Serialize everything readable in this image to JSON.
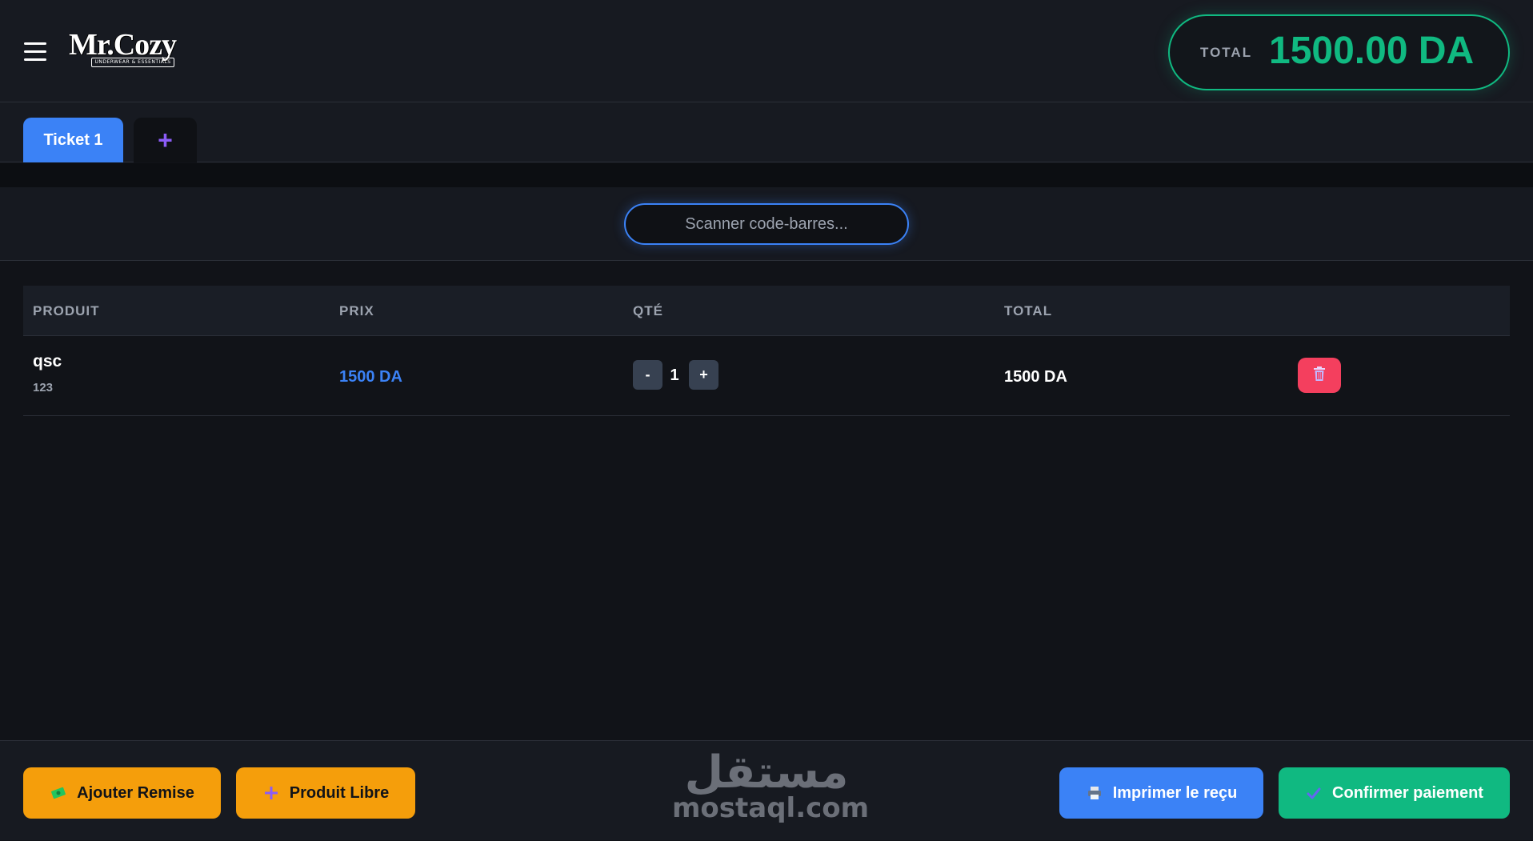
{
  "header": {
    "logo_text": "Mr.Cozy",
    "logo_tagline": "UNDERWEAR & ESSENTIALS",
    "total_label": "TOTAL",
    "total_value": "1500.00 DA"
  },
  "tabs": {
    "items": [
      {
        "label": "Ticket 1",
        "active": true
      }
    ],
    "add_label": "+"
  },
  "scanner": {
    "placeholder": "Scanner code-barres..."
  },
  "table": {
    "columns": [
      "PRODUIT",
      "PRIX",
      "QTÉ",
      "TOTAL"
    ],
    "rows": [
      {
        "name": "qsc",
        "code": "123",
        "price": "1500 DA",
        "qty": "1",
        "total": "1500 DA",
        "minus_label": "-",
        "plus_label": "+"
      }
    ]
  },
  "footer": {
    "buttons": {
      "remise": "Ajouter Remise",
      "libre": "Produit Libre",
      "print": "Imprimer le reçu",
      "confirm": "Confirmer paiement"
    },
    "watermark_ar": "مستقل",
    "watermark_en": "mostaql.com"
  },
  "colors": {
    "accent_blue": "#3b82f6",
    "accent_green": "#10b981",
    "accent_orange": "#f59e0b",
    "danger": "#f43f5e",
    "purple": "#8b5cf6"
  },
  "icons": {
    "menu": "hamburger-menu-icon",
    "add_tab": "plus-icon",
    "delete": "trash-icon",
    "remise": "money-icon",
    "libre": "plus-icon",
    "print": "printer-icon",
    "confirm": "check-icon"
  }
}
